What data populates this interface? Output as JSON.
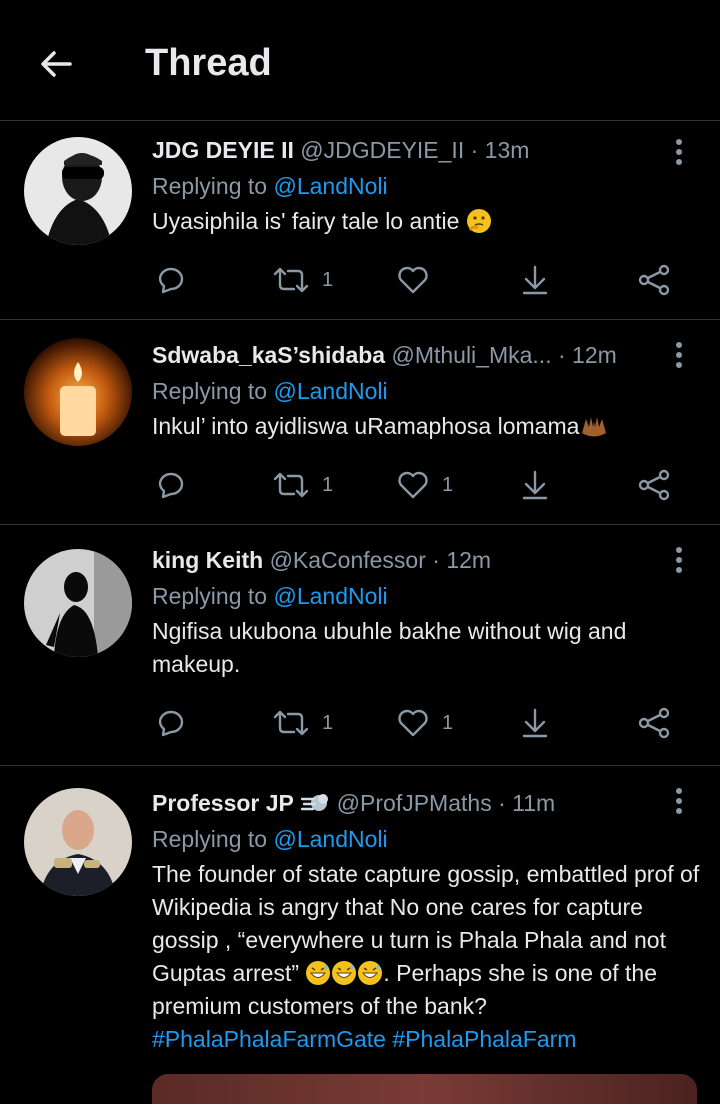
{
  "header": {
    "title": "Thread",
    "back_icon": "back-arrow-icon"
  },
  "tweets": [
    {
      "name": "JDG DEYIE II",
      "handle": "@JDGDEYIE_II",
      "time": "13m",
      "replying_prefix": "Replying to",
      "replying_to": "@LandNoli",
      "text": "Uyasiphila is' fairy tale lo antie",
      "emoji": "thinking-face",
      "retweets": "1",
      "likes": ""
    },
    {
      "name": "Sdwaba_kaS’shidaba",
      "handle": "@Mthuli_Mka...",
      "time": "12m",
      "replying_prefix": "Replying to",
      "replying_to": "@LandNoli",
      "text": "Inkul’ into ayidliswa uRamaphosa lomama",
      "emoji": "raising-hands",
      "retweets": "1",
      "likes": "1"
    },
    {
      "name": "king Keith",
      "handle": "@KaConfessor",
      "time": "12m",
      "replying_prefix": "Replying to",
      "replying_to": "@LandNoli",
      "text": "Ngifisa ukubona ubuhle bakhe without wig and makeup.",
      "retweets": "1",
      "likes": "1"
    },
    {
      "name": "Professor JP",
      "handle": "@ProfJPMaths",
      "time": "11m",
      "replying_prefix": "Replying to",
      "replying_to": "@LandNoli",
      "text_before": "The founder of state capture gossip, embattled prof of Wikipedia is angry that No one cares for capture gossip , “everywhere u turn is Phala Phala and not Guptas arrest” ",
      "text_after": ". Perhaps she is one of the premium customers of the bank? ",
      "hashtag1": "#PhalaPhalaFarmGate",
      "hashtag2": "#PhalaPhalaFarm",
      "name_emoji": "dashing-away",
      "emoji": "grinning-sweat"
    }
  ],
  "colors": {
    "background": "#000000",
    "text": "#e7e9ea",
    "muted": "#8b98a5",
    "link": "#1d9bf0",
    "divider": "#2f3336"
  }
}
